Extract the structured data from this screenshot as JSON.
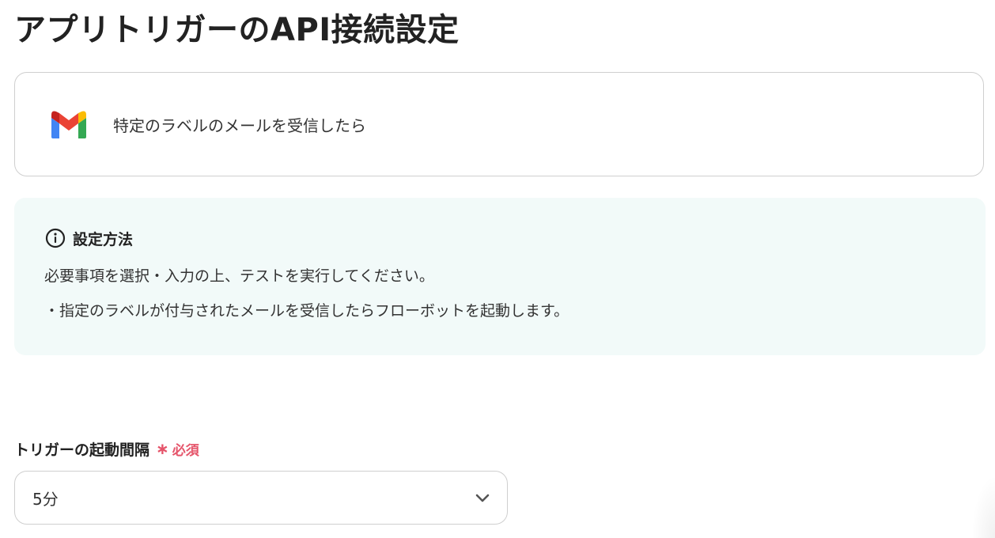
{
  "page": {
    "title": "アプリトリガーのAPI接続設定"
  },
  "trigger": {
    "icon": "gmail-icon",
    "label": "特定のラベルのメールを受信したら"
  },
  "info": {
    "icon": "info-icon",
    "title": "設定方法",
    "lines": [
      "必要事項を選択・入力の上、テストを実行してください。",
      "・指定のラベルが付与されたメールを受信したらフローボットを起動します。"
    ],
    "background_color": "#f2faf9"
  },
  "interval_field": {
    "label": "トリガーの起動間隔",
    "required_mark": "∗",
    "required_text": "必須",
    "required_color": "#e5546a",
    "selected_value": "5分",
    "dropdown_icon": "chevron-down-icon"
  }
}
